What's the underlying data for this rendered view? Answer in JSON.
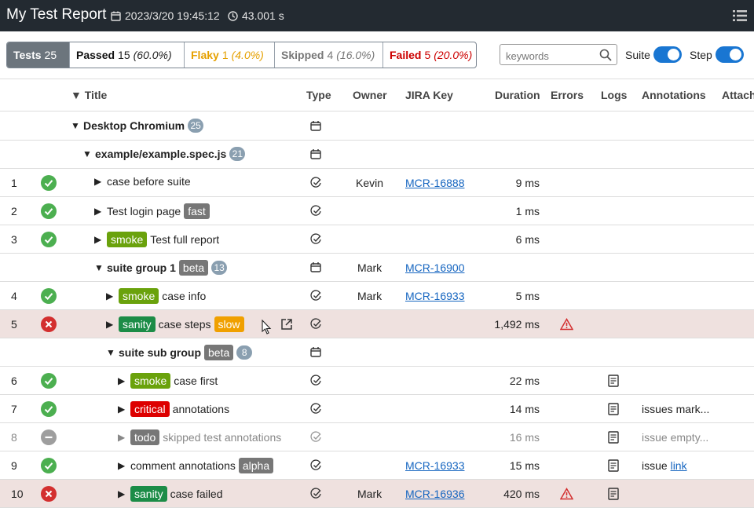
{
  "header": {
    "title": "My Test Report",
    "date": "2023/3/20 19:45:12",
    "duration": "43.001 s"
  },
  "tabs": [
    {
      "label": "Tests",
      "count": "25",
      "percent": ""
    },
    {
      "label": "Passed",
      "count": "15",
      "percent": "(60.0%)"
    },
    {
      "label": "Flaky",
      "count": "1",
      "percent": "(4.0%)"
    },
    {
      "label": "Skipped",
      "count": "4",
      "percent": "(16.0%)"
    },
    {
      "label": "Failed",
      "count": "5",
      "percent": "(20.0%)"
    }
  ],
  "search": {
    "placeholder": "keywords"
  },
  "toggles": {
    "suite_label": "Suite",
    "step_label": "Step"
  },
  "columns": {
    "title": "Title",
    "type": "Type",
    "owner": "Owner",
    "jira": "JIRA Key",
    "duration": "Duration",
    "errors": "Errors",
    "logs": "Logs",
    "annotations": "Annotations",
    "attach": "Attach"
  },
  "rows": {
    "r0": {
      "title": "Desktop Chromium",
      "count": "25"
    },
    "r1": {
      "title": "example/example.spec.js",
      "count": "21"
    },
    "r2": {
      "index": "1",
      "title": "case before suite",
      "owner": "Kevin",
      "jira": "MCR-16888",
      "duration": "9 ms"
    },
    "r3": {
      "index": "2",
      "title": "Test login page",
      "tag1": "fast",
      "duration": "1 ms"
    },
    "r4": {
      "index": "3",
      "tag0": "smoke",
      "title": "Test full report",
      "duration": "6 ms"
    },
    "r5": {
      "title": "suite group 1",
      "tag1": "beta",
      "count": "13",
      "owner": "Mark",
      "jira": "MCR-16900"
    },
    "r6": {
      "index": "4",
      "tag0": "smoke",
      "title": "case info",
      "owner": "Mark",
      "jira": "MCR-16933",
      "duration": "5 ms"
    },
    "r7": {
      "index": "5",
      "tag0": "sanity",
      "title": "case steps",
      "tag1": "slow",
      "duration": "1,492 ms"
    },
    "r8": {
      "title": "suite sub group",
      "tag1": "beta",
      "count": "8"
    },
    "r9": {
      "index": "6",
      "tag0": "smoke",
      "title": "case first",
      "duration": "22 ms"
    },
    "r10": {
      "index": "7",
      "tag0": "critical",
      "title": "annotations",
      "duration": "14 ms",
      "annotation": "issues mark..."
    },
    "r11": {
      "index": "8",
      "tag0": "todo",
      "title": "skipped test annotations",
      "duration": "16 ms",
      "annotation": "issue empty..."
    },
    "r12": {
      "index": "9",
      "title": "comment annotations",
      "tag1": "alpha",
      "jira": "MCR-16933",
      "duration": "15 ms",
      "annotation_text": "issue",
      "annotation_link": "link"
    },
    "r13": {
      "index": "10",
      "tag0": "sanity",
      "title": "case failed",
      "owner": "Mark",
      "jira": "MCR-16936",
      "duration": "420 ms"
    }
  },
  "colors": {
    "header_bg": "#232a31",
    "passed": "#4caf50",
    "failed": "#d32f2f",
    "skipped": "#9e9e9e",
    "toggle": "#1976d2",
    "failed_row_bg": "#efe1df"
  },
  "icons": [
    "calendar-icon",
    "clock-icon",
    "menu-icon",
    "search-icon",
    "suite-box-icon",
    "case-check-icon",
    "warning-icon",
    "log-document-icon",
    "external-link-icon",
    "cursor-icon"
  ]
}
